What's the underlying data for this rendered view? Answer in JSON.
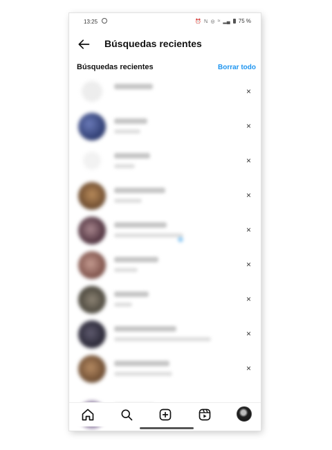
{
  "status_bar": {
    "time": "13:25",
    "battery": "75 %",
    "icons": [
      "whatsapp-icon",
      "alarm-icon",
      "nfc-icon",
      "hotspot-icon",
      "wifi-icon",
      "signal-icon",
      "battery-icon"
    ]
  },
  "header": {
    "title": "Búsquedas recientes",
    "back_icon": "arrow-left-icon"
  },
  "section": {
    "title": "Búsquedas recientes",
    "clear_all_label": "Borrar todo"
  },
  "recent_searches": [
    {
      "kind": "search",
      "remove_label": "×"
    },
    {
      "kind": "account",
      "remove_label": "×"
    },
    {
      "kind": "search",
      "remove_label": "×"
    },
    {
      "kind": "account",
      "remove_label": "×"
    },
    {
      "kind": "account",
      "remove_label": "×"
    },
    {
      "kind": "account",
      "remove_label": "×"
    },
    {
      "kind": "account",
      "remove_label": "×"
    },
    {
      "kind": "account",
      "remove_label": "×"
    },
    {
      "kind": "account",
      "remove_label": "×"
    },
    {
      "kind": "account",
      "remove_label": "×"
    }
  ],
  "bottom_nav": [
    "home-icon",
    "search-icon",
    "create-icon",
    "reels-icon",
    "profile-avatar"
  ],
  "colors": {
    "accent": "#1e95f0",
    "text": "#111111"
  }
}
